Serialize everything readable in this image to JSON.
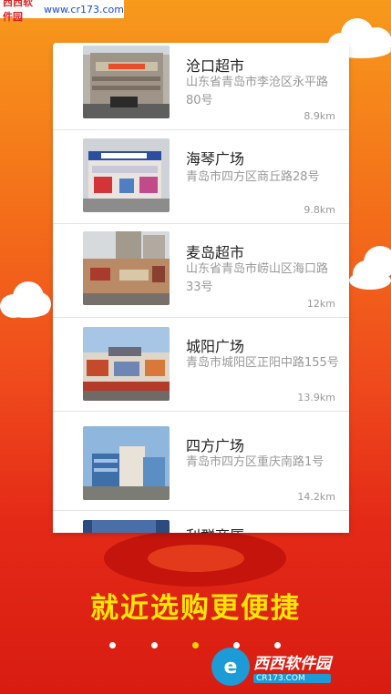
{
  "watermark_top": {
    "site_name": "西西软件园",
    "url": "www.cr173.com"
  },
  "stores": [
    {
      "name": "沧口超市",
      "address": "山东省青岛市李沧区永平路80号",
      "distance": "8.9km"
    },
    {
      "name": "海琴广场",
      "address": "青岛市四方区商丘路28号",
      "distance": "9.8km"
    },
    {
      "name": "麦岛超市",
      "address": "山东省青岛市崂山区海口路33号",
      "distance": "12km"
    },
    {
      "name": "城阳广场",
      "address": "青岛市城阳区正阳中路155号",
      "distance": "13.9km"
    },
    {
      "name": "四方广场",
      "address": "青岛市四方区重庆南路1号",
      "distance": "14.2km"
    },
    {
      "name": "利群商厦"
    }
  ],
  "slogan": "就近选购更便捷",
  "pager": {
    "count": 5,
    "active_index": 2
  },
  "watermark_logo": {
    "title": "西西软件园",
    "url": "CR173.COM"
  }
}
